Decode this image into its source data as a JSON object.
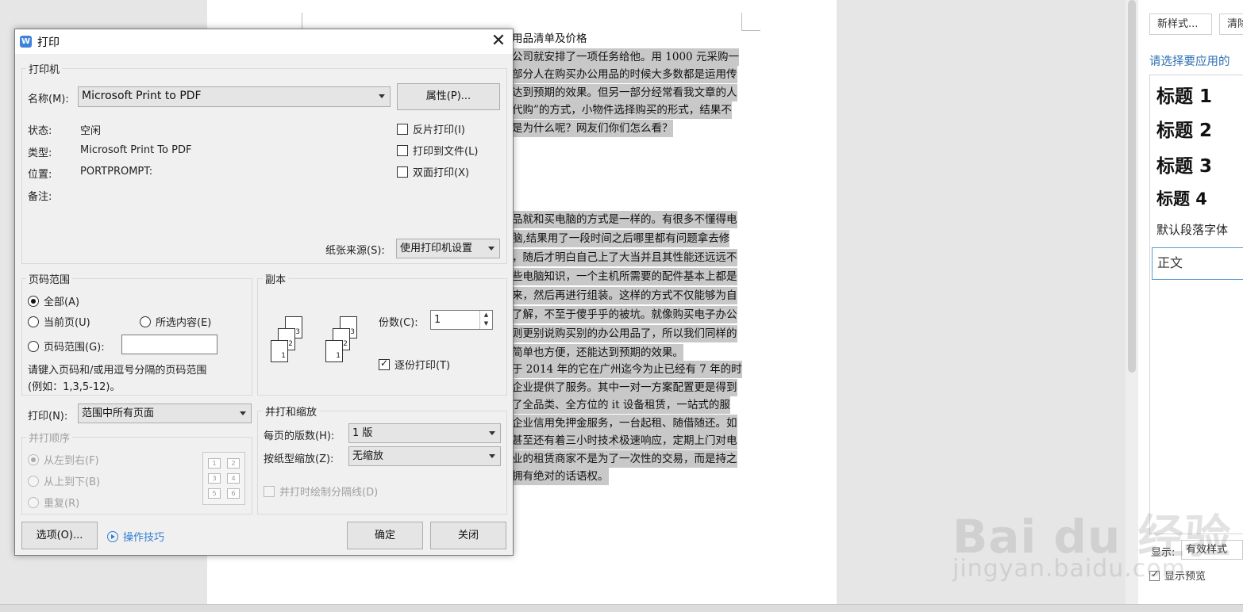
{
  "document": {
    "lines_top": [
      {
        "text": "用品清单及价格",
        "hl": false
      },
      {
        "text": "公司就安排了一项任务给他。用 1000 元采购一",
        "hl": true
      },
      {
        "text": "部分人在购买办公用品的时候大多数都是运用传",
        "hl": true
      },
      {
        "text": "达到预期的效果。但另一部分经常看我文章的人",
        "hl": true
      },
      {
        "text": "代购”的方式，小物件选择购买的形式，结果不",
        "hl": true
      },
      {
        "text": "是为什么呢？网友们你们怎么看？",
        "hl": true
      }
    ],
    "lines_mid": [
      "品就和买电脑的方式是一样的。有很多不懂得电",
      "脑,结果用了一段时间之后哪里都有问题拿去修",
      "，随后才明白自己上了大当并且其性能还远远不",
      "些电脑知识，一个主机所需要的配件基本上都是",
      "来，然后再进行组装。这样的方式不仅能够为自",
      "了解，不至于傻乎乎的被坑。就像购买电子办公",
      "则更别说购买别的办公用品了，所以我们同样的",
      "简单也方便，还能达到预期的效果。"
    ],
    "lines_bottom": [
      "于 2014 年的它在广州迄今为止已经有 7 年的时",
      "企业提供了服务。其中一对一方案配置更是得到",
      "了全品类、全方位的 it 设备租赁，一站式的服",
      "企业信用免押金服务，一台起租、随借随还。如",
      "甚至还有着三小时技术极速响应，定期上门对电",
      "业的租赁商家不是为了一次性的交易，而是持之",
      "拥有绝对的话语权。"
    ]
  },
  "side_pane": {
    "new_style_button": "新样式...",
    "clear_button": "清除",
    "select_label": "请选择要应用的",
    "styles": [
      "标题 1",
      "标题 2",
      "标题 3",
      "标题 4"
    ],
    "default_font": "默认段落字体",
    "body_style": "正文",
    "show_label": "显示:",
    "show_value": "有效样式",
    "preview_label": "显示预览"
  },
  "watermark": {
    "brand": "Bai du 经验",
    "url": "jingyan.baidu.com"
  },
  "dialog": {
    "title": "打印",
    "printer": {
      "group_label": "打印机",
      "name_label": "名称(M):",
      "name_value": "Microsoft Print to PDF",
      "properties_button": "属性(P)...",
      "status_label": "状态:",
      "status_value": "空闲",
      "type_label": "类型:",
      "type_value": "Microsoft Print To PDF",
      "location_label": "位置:",
      "location_value": "PORTPROMPT:",
      "comment_label": "备注:",
      "reverse_print": "反片打印(I)",
      "print_to_file": "打印到文件(L)",
      "duplex_print": "双面打印(X)",
      "paper_source_label": "纸张来源(S):",
      "paper_source_value": "使用打印机设置"
    },
    "page_range": {
      "group_label": "页码范围",
      "all": "全部(A)",
      "current_page": "当前页(U)",
      "selection": "所选内容(E)",
      "pages": "页码范围(G):",
      "pages_value": "",
      "hint_line1": "请键入页码和/或用逗号分隔的页码范围",
      "hint_line2": "(例如：1,3,5-12)。"
    },
    "copies": {
      "group_label": "副本",
      "count_label": "份数(C):",
      "count_value": "1",
      "collate": "逐份打印(T)"
    },
    "print_what": {
      "label": "打印(N):",
      "value": "范围中所有页面"
    },
    "order": {
      "group_label": "并打顺序",
      "left_to_right": "从左到右(F)",
      "top_to_bottom": "从上到下(B)",
      "repeat": "重复(R)"
    },
    "zoom": {
      "group_label": "并打和缩放",
      "pages_per_sheet_label": "每页的版数(H):",
      "pages_per_sheet_value": "1 版",
      "scale_label": "按纸型缩放(Z):",
      "scale_value": "无缩放",
      "draw_borders": "并打时绘制分隔线(D)"
    },
    "options_button": "选项(O)...",
    "tips_link": "操作技巧",
    "ok_button": "确定",
    "close_button": "关闭"
  }
}
